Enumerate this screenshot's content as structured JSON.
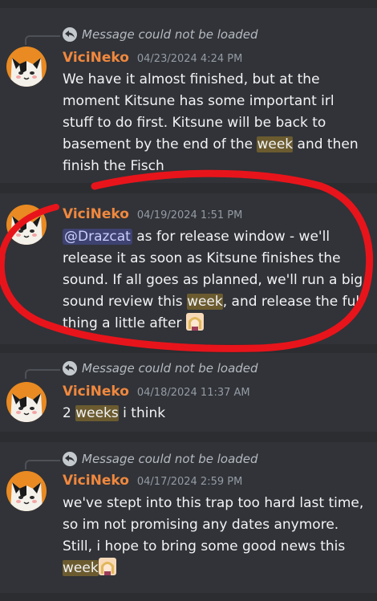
{
  "messages": [
    {
      "reply_text": "Message could not be loaded",
      "author": "ViciNeko",
      "timestamp": "04/23/2024 4:24 PM",
      "segments": [
        {
          "t": "We have it almost finished, but at the moment Kitsune has some important irl stuff to do first. Kitsune will be back to basement by the end of the "
        },
        {
          "t": "week",
          "hl": true
        },
        {
          "t": " and then finish the Fisch"
        }
      ]
    },
    {
      "author": "ViciNeko",
      "timestamp": "04/19/2024 1:51 PM",
      "segments": [
        {
          "t": "@Drazcat",
          "mention": true
        },
        {
          "t": " as for release window - we'll release it as soon as Kitsune finishes the sound. If all goes as planned, we'll run a big sound review this "
        },
        {
          "t": "week",
          "hl": true
        },
        {
          "t": ", and release the full thing a little after "
        }
      ],
      "emoji": "girl-emoji"
    },
    {
      "reply_text": "Message could not be loaded",
      "author": "ViciNeko",
      "timestamp": "04/18/2024 11:37 AM",
      "segments": [
        {
          "t": "2 "
        },
        {
          "t": "weeks",
          "hl": true
        },
        {
          "t": " i think"
        }
      ]
    },
    {
      "reply_text": "Message could not be loaded",
      "author": "ViciNeko",
      "timestamp": "04/17/2024 2:59 PM",
      "segments": [
        {
          "t": "we've stept into this trap too hard last time, so im not promising any dates anymore. Still, i hope to bring some good news this "
        },
        {
          "t": "week",
          "hl": true
        }
      ],
      "emoji": "girl-emoji"
    }
  ],
  "colors": {
    "author": "#f0883e",
    "highlight": "#6b5b2f",
    "annotation": "#e8141b"
  }
}
